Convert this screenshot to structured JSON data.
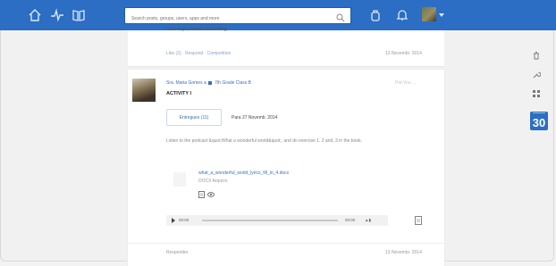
{
  "topbar": {
    "search_placeholder": "Search posts, groups, users, apps and more"
  },
  "prev_post": {
    "fragment": "l and days, basses and sorting",
    "like_label": "Like (2)",
    "reply_label": "Respond",
    "share_label": "Competition",
    "date": "13 Novembr. 2014"
  },
  "post": {
    "author": "Sra. Maria Gomes",
    "group": "7th Grade Class B",
    "action_label": "Pot Vou ...",
    "title": "ACTIVITY I",
    "submit_label": "Entregues (11)",
    "deadline": "Para 27 Novemb. 2014",
    "description": "Listen to the podcast &quot;What a wonderful world&quot;, and do exercise 1. 2 and, 3 in the book.",
    "file": {
      "name": "what_a_wonderful_world_lyrics_fill_in_4.docx",
      "type": "DOCX Arquivo"
    },
    "player": {
      "current_time": "00:00",
      "duration": "00:00"
    },
    "footer_label": "Responder",
    "footer_date": "13 Novembr. 2014"
  },
  "calendar": {
    "day": "30"
  }
}
